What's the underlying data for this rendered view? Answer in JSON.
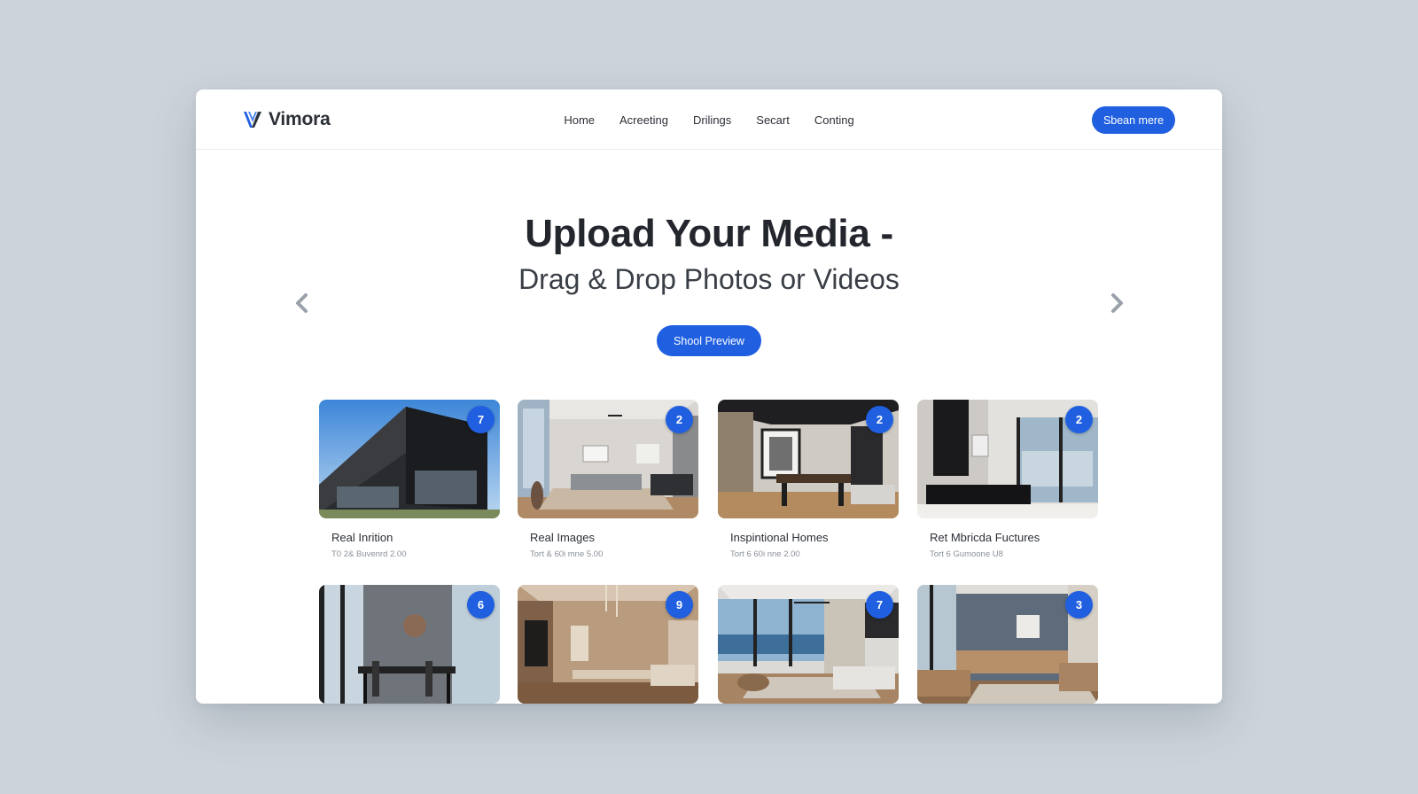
{
  "brand": {
    "name": "Vimora",
    "accent": "#1f5fe0"
  },
  "nav": {
    "links": [
      "Home",
      "Acreeting",
      "Drilings",
      "Secart",
      "Conting"
    ],
    "cta": "Sbean mere"
  },
  "hero": {
    "title": "Upload Your Media -",
    "subtitle": "Drag & Drop Photos or Videos",
    "button": "Shool Preview"
  },
  "carousel": {
    "prev_icon": "chevron-left-icon",
    "next_icon": "chevron-right-icon"
  },
  "gallery": {
    "row1": [
      {
        "title": "Real Inrition",
        "meta": "T0 2& Buvenrd 2.00",
        "badge": "7",
        "scene": "building"
      },
      {
        "title": "Real Images",
        "meta": "Tort & 60i mne 5.00",
        "badge": "2",
        "scene": "living"
      },
      {
        "title": "Inspintional Homes",
        "meta": "Tort 6 60i nne 2.00",
        "badge": "2",
        "scene": "dining"
      },
      {
        "title": "Ret Mbricda Fuctures",
        "meta": "Tort 6 Gumoone U8",
        "badge": "2",
        "scene": "bathroom"
      }
    ],
    "row2": [
      {
        "badge": "6",
        "scene": "glass-dining"
      },
      {
        "badge": "9",
        "scene": "warm-dining"
      },
      {
        "badge": "7",
        "scene": "ocean-living"
      },
      {
        "badge": "3",
        "scene": "lounge"
      }
    ]
  }
}
